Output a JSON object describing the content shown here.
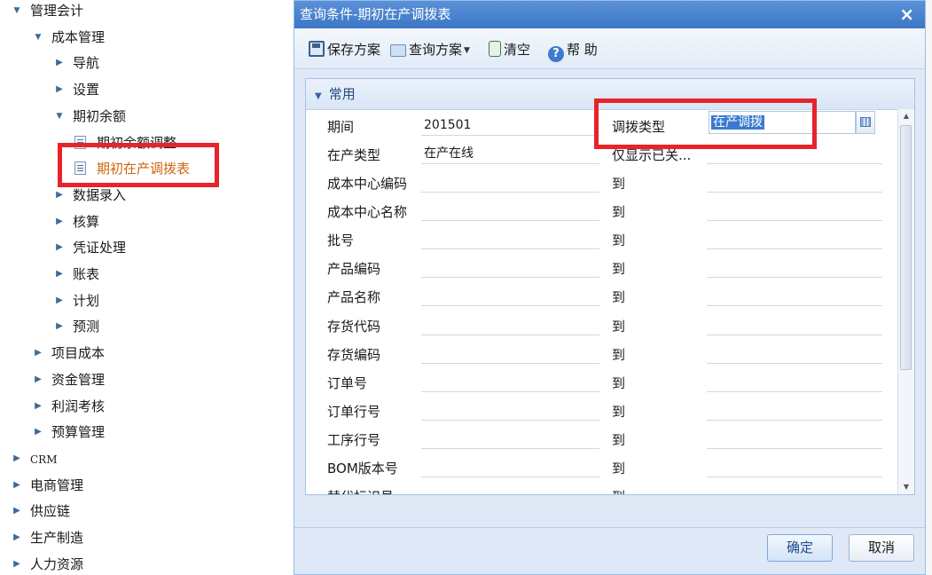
{
  "tree": {
    "items": [
      {
        "label": "管理会计",
        "level": 0,
        "expanded": true
      },
      {
        "label": "成本管理",
        "level": 1,
        "expanded": true
      },
      {
        "label": "导航",
        "level": 2,
        "expanded": false
      },
      {
        "label": "设置",
        "level": 2,
        "expanded": false
      },
      {
        "label": "期初余额",
        "level": 2,
        "expanded": true
      },
      {
        "label": "期初余额调整",
        "level": 3,
        "leaf": true
      },
      {
        "label": "期初在产调拨表",
        "level": 3,
        "leaf": true,
        "active": true
      },
      {
        "label": "数据录入",
        "level": 2,
        "expanded": false
      },
      {
        "label": "核算",
        "level": 2,
        "expanded": false
      },
      {
        "label": "凭证处理",
        "level": 2,
        "expanded": false
      },
      {
        "label": "账表",
        "level": 2,
        "expanded": false
      },
      {
        "label": "计划",
        "level": 2,
        "expanded": false
      },
      {
        "label": "预测",
        "level": 2,
        "expanded": false
      },
      {
        "label": "项目成本",
        "level": 1,
        "expanded": false
      },
      {
        "label": "资金管理",
        "level": 1,
        "expanded": false
      },
      {
        "label": "利润考核",
        "level": 1,
        "expanded": false
      },
      {
        "label": "预算管理",
        "level": 1,
        "expanded": false
      },
      {
        "label": "CRM",
        "level": 0,
        "expanded": false
      },
      {
        "label": "电商管理",
        "level": 0,
        "expanded": false
      },
      {
        "label": "供应链",
        "level": 0,
        "expanded": false
      },
      {
        "label": "生产制造",
        "level": 0,
        "expanded": false
      },
      {
        "label": "人力资源",
        "level": 0,
        "expanded": false
      }
    ]
  },
  "dialog": {
    "title": "查询条件-期初在产调拨表",
    "close_symbol": "×",
    "toolbar": {
      "save_plan": "保存方案",
      "query_plan": "查询方案",
      "clear": "清空",
      "help": "帮 助"
    },
    "group_title": "常用",
    "form": {
      "period_label": "期间",
      "period_value": "201501",
      "transfer_type_label": "调拨类型",
      "transfer_type_value": "在产调拨",
      "wip_type_label": "在产类型",
      "wip_type_value": "在产在线",
      "show_closed_label": "仅显示已关...",
      "range_rows": [
        {
          "label": "成本中心编码",
          "to": "到"
        },
        {
          "label": "成本中心名称",
          "to": "到"
        },
        {
          "label": "批号",
          "to": "到"
        },
        {
          "label": "产品编码",
          "to": "到"
        },
        {
          "label": "产品名称",
          "to": "到"
        },
        {
          "label": "存货代码",
          "to": "到"
        },
        {
          "label": "存货编码",
          "to": "到"
        },
        {
          "label": "订单号",
          "to": "到"
        },
        {
          "label": "订单行号",
          "to": "到"
        },
        {
          "label": "工序行号",
          "to": "到"
        },
        {
          "label": "BOM版本号",
          "to": "到"
        },
        {
          "label": "替代标识号",
          "to": "到"
        }
      ]
    },
    "footer": {
      "ok": "确定",
      "cancel": "取消"
    }
  },
  "colors": {
    "highlight_red": "#e8232a",
    "title_blue": "#3c76c5",
    "active_node_orange": "#d0650e"
  }
}
